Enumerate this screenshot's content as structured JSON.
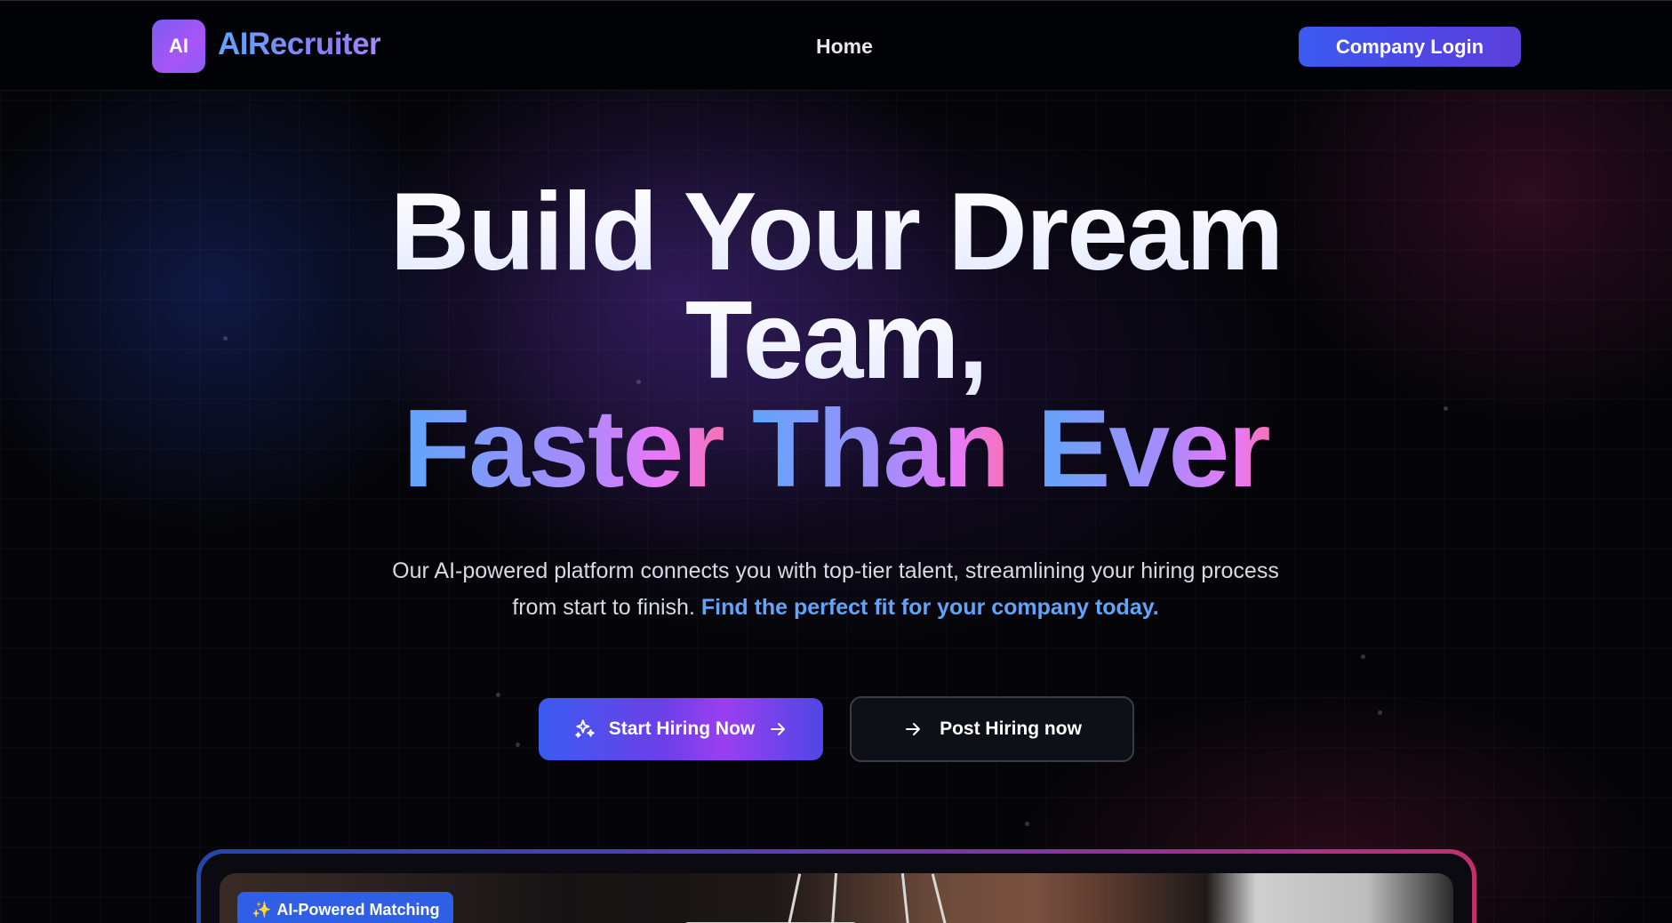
{
  "nav": {
    "logo_mark": "AI",
    "brand": "AIRecruiter",
    "links": [
      {
        "label": "Home"
      }
    ],
    "login_label": "Company Login"
  },
  "hero": {
    "title_line1": "Build Your Dream",
    "title_line2": "Team,",
    "title_line3_words": [
      "Faster",
      "Than",
      "Ever"
    ],
    "subtitle_plain": "Our AI-powered platform connects you with top-tier talent, streamlining your hiring process from start to finish.",
    "subtitle_highlight": "Find the perfect fit for your company today.",
    "primary_cta": {
      "label": "Start Hiring Now",
      "icon": "sparkles-icon",
      "trailing_icon": "arrow-right-icon"
    },
    "secondary_cta": {
      "label": "Post Hiring now",
      "icon": "arrow-right-icon"
    }
  },
  "preview": {
    "badge_emoji": "✨",
    "badge_label": "AI-Powered Matching"
  },
  "colors": {
    "accent_blue": "#3b5bf0",
    "accent_purple": "#a855f7",
    "accent_pink": "#f472b6",
    "highlight_text": "#60a5fa"
  }
}
